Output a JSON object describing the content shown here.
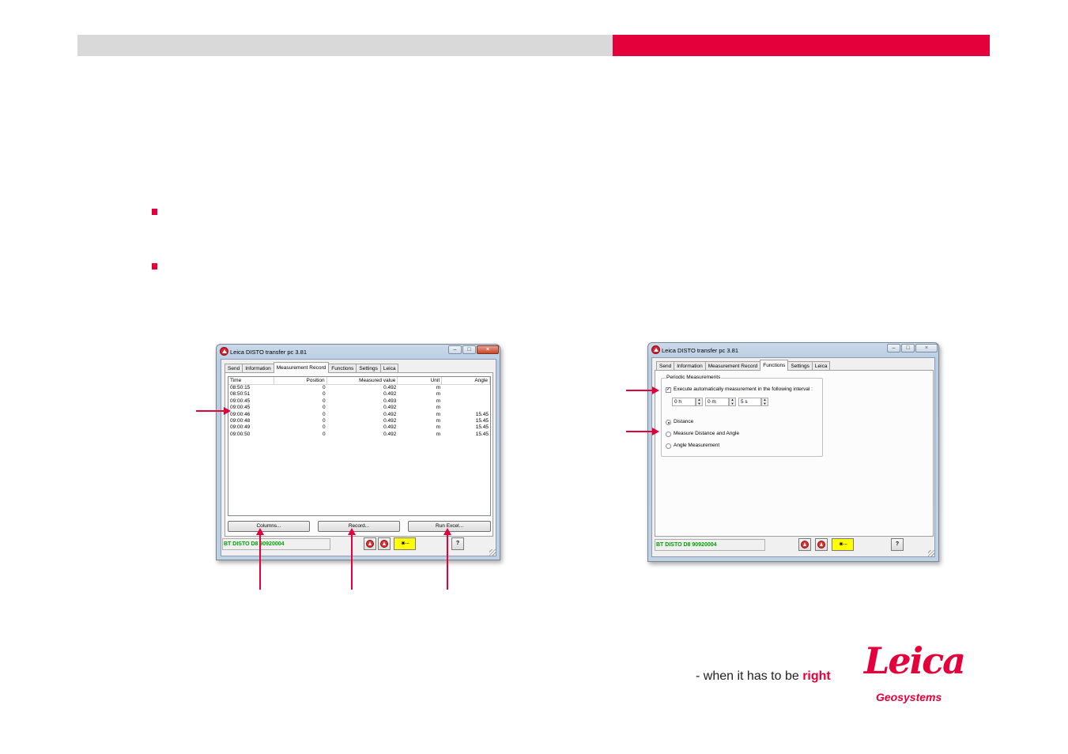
{
  "slide": {
    "colors": {
      "accent": "#e4003b",
      "header_grey": "#d9d9d9"
    }
  },
  "window_left": {
    "title": "Leica DISTO transfer pc 3.81",
    "tabs": [
      "Send",
      "Information",
      "Measurement Record",
      "Functions",
      "Settings",
      "Leica"
    ],
    "active_tab": "Measurement Record",
    "columns": [
      "Time",
      "Position",
      "Measured value",
      "Unit",
      "Angle"
    ],
    "rows": [
      [
        "08:50:15",
        "0",
        "0.492",
        "m",
        ""
      ],
      [
        "08:50:51",
        "0",
        "0.492",
        "m",
        ""
      ],
      [
        "09:00:45",
        "0",
        "0.493",
        "m",
        ""
      ],
      [
        "09:00:45",
        "0",
        "0.492",
        "m",
        ""
      ],
      [
        "09:00:46",
        "0",
        "0.492",
        "m",
        "15.45"
      ],
      [
        "09:00:48",
        "0",
        "0.492",
        "m",
        "15.45"
      ],
      [
        "09:00:49",
        "0",
        "0.492",
        "m",
        "15.45"
      ],
      [
        "09:00:50",
        "0",
        "0.492",
        "m",
        "15.45"
      ]
    ],
    "buttons": {
      "columns": "Columns...",
      "record": "Record...",
      "run_excel": "Run Excel..."
    },
    "status": "BT DISTO D8 90920004",
    "help": "?"
  },
  "window_right": {
    "title": "Leica DISTO transfer pc 3.81",
    "tabs": [
      "Send",
      "Information",
      "Measurement Record",
      "Functions",
      "Settings",
      "Leica"
    ],
    "active_tab": "Functions",
    "group_title": "Periodic Measurements",
    "auto_checkbox": {
      "label": "Execute automatically measurement in the following interval :",
      "checked": true
    },
    "interval": {
      "hours": "0 h",
      "minutes": "0 m",
      "seconds": "5 s"
    },
    "modes": [
      {
        "label": "Distance",
        "selected": true
      },
      {
        "label": "Measure Distance and Angle",
        "selected": false
      },
      {
        "label": "Angle Measurement",
        "selected": false
      }
    ],
    "status": "BT DISTO D8 90920004",
    "help": "?"
  },
  "branding": {
    "tagline_prefix": "- when it has to be ",
    "tagline_emphasis": "right",
    "logo_wordmark": "Leica",
    "logo_subtitle": "Geosystems"
  }
}
